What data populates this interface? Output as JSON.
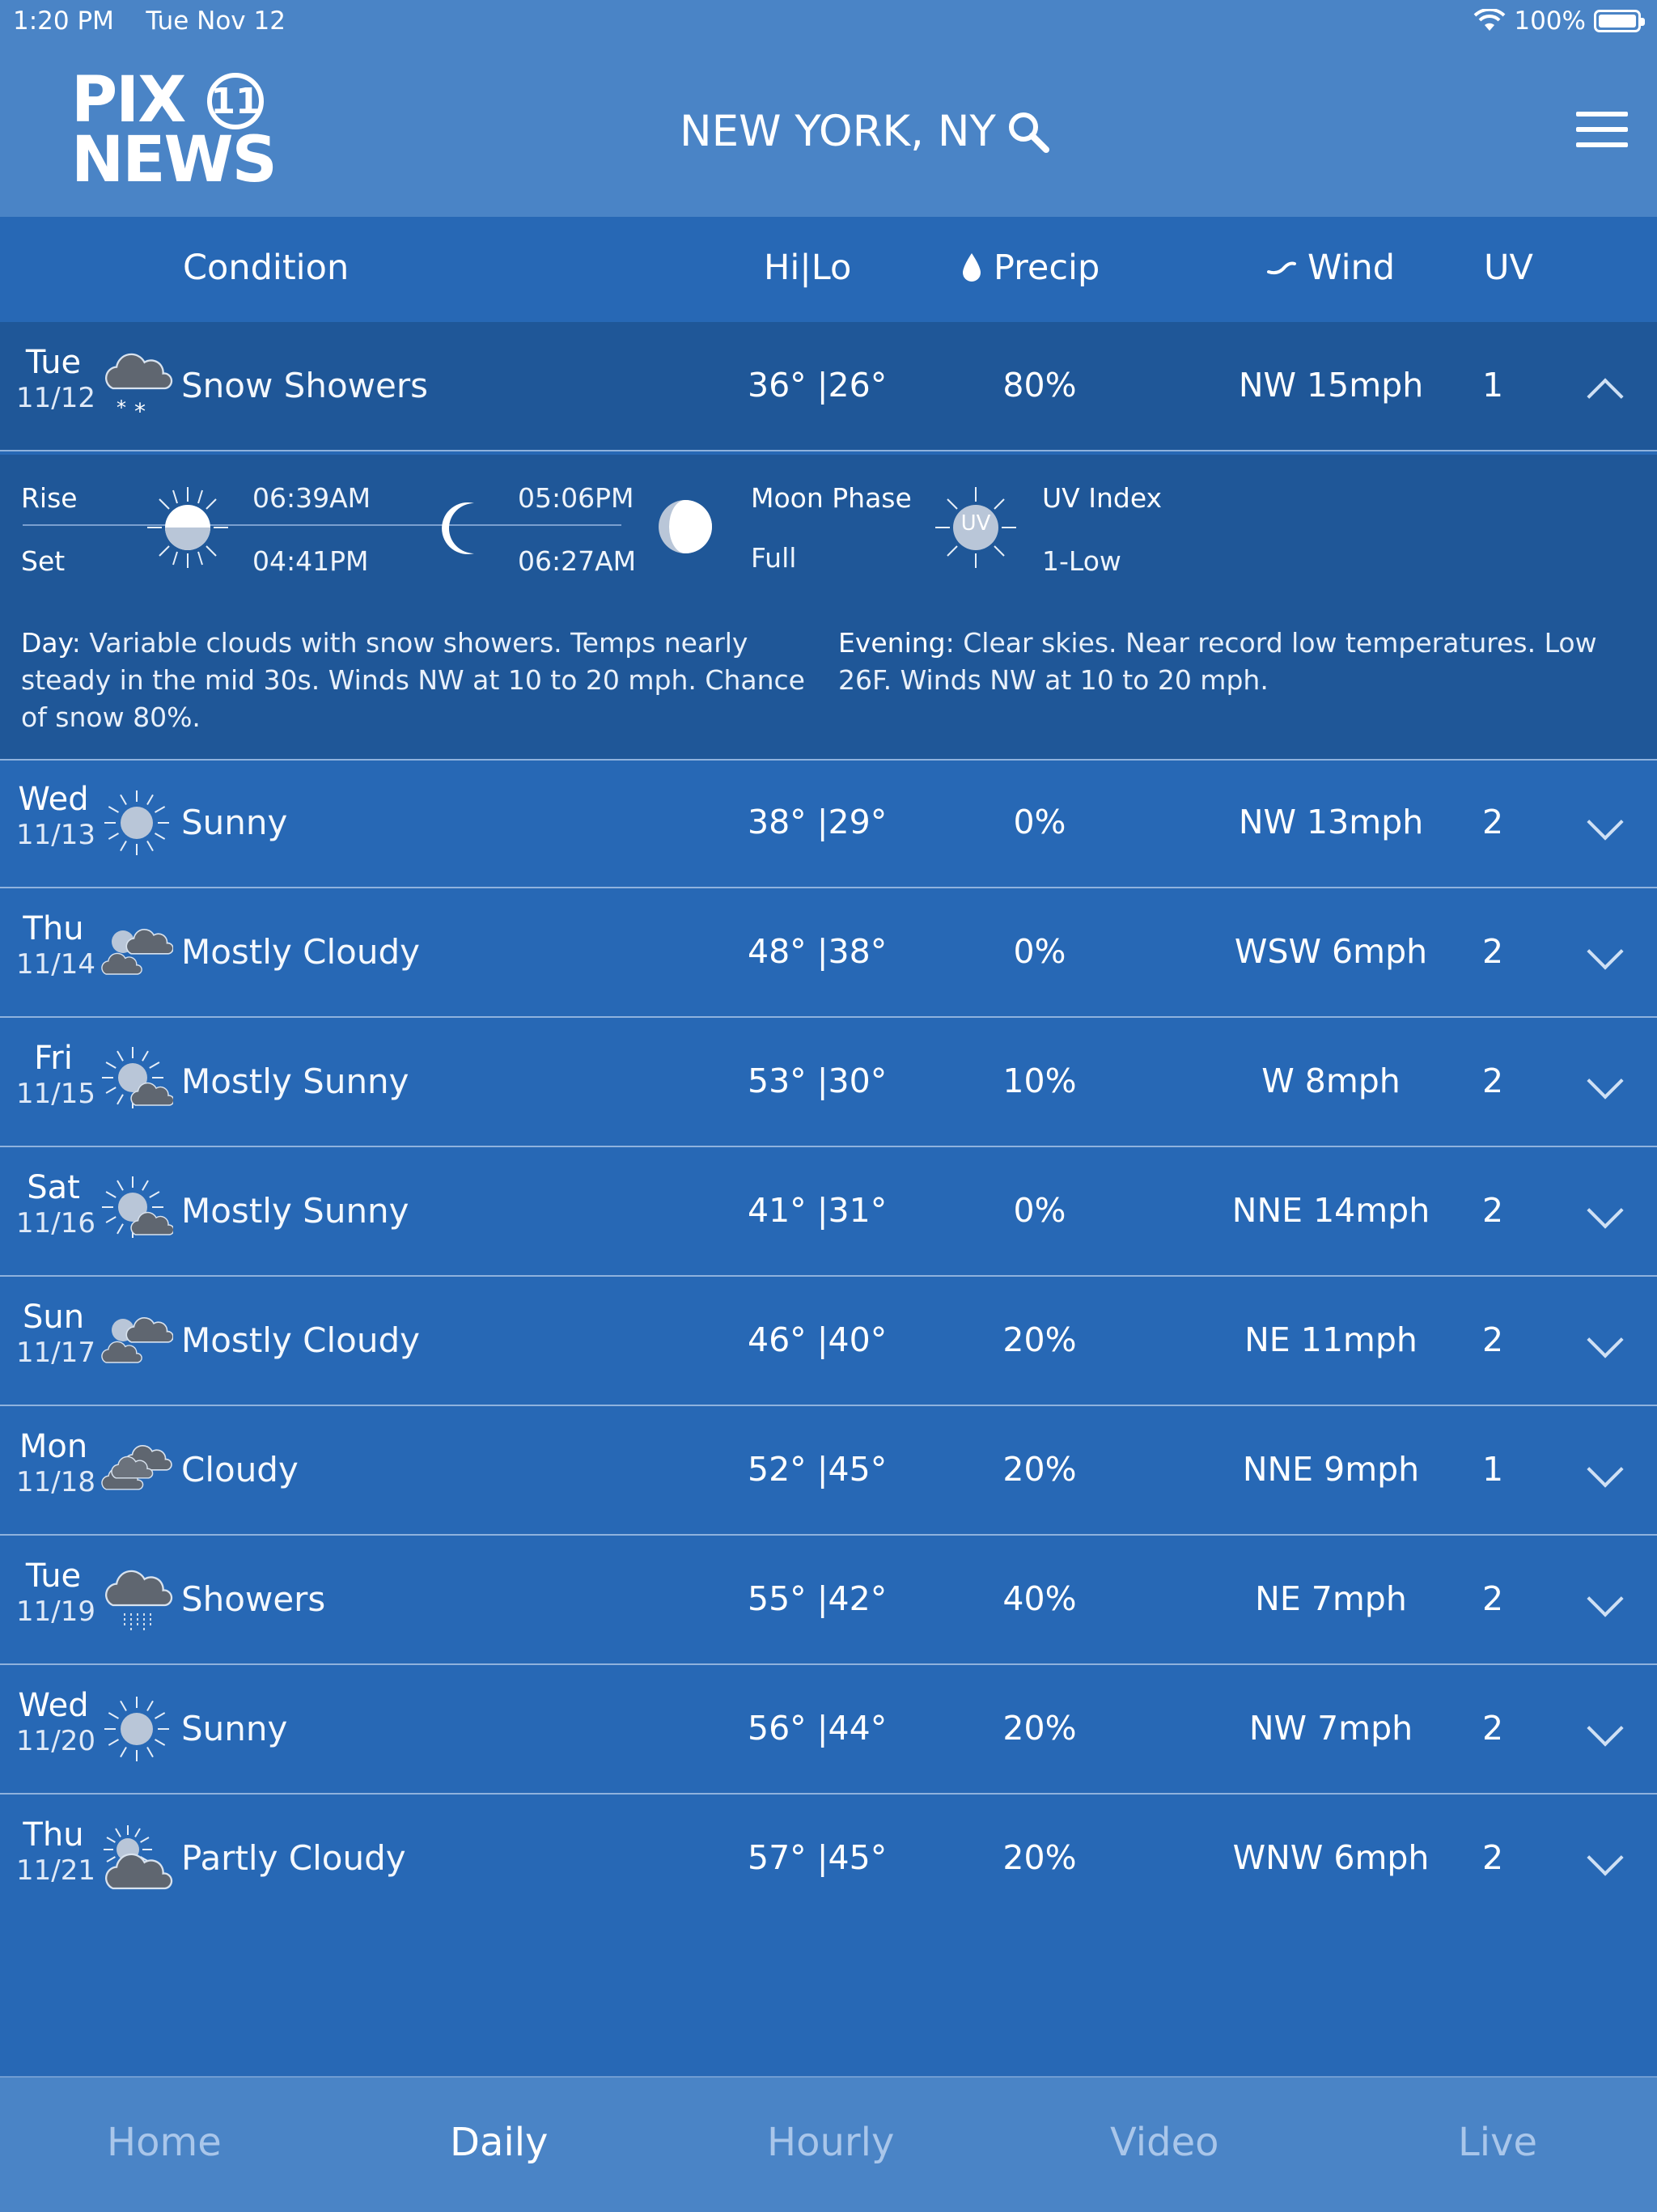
{
  "status": {
    "time": "1:20 PM",
    "date": "Tue Nov 12",
    "battery": "100%"
  },
  "header": {
    "location": "NEW YORK, NY",
    "logo_top": "PIX",
    "logo_badge": "11",
    "logo_bottom": "NEWS"
  },
  "columns": {
    "condition": "Condition",
    "hilo": "Hi|Lo",
    "precip": "Precip",
    "wind": "Wind",
    "uv": "UV"
  },
  "rows": [
    {
      "day": "Tue",
      "date": "11/12",
      "icon": "snow-showers-icon",
      "condition": "Snow Showers",
      "hilo": "36° |26°",
      "precip": "80%",
      "wind": "NW 15mph",
      "uv": "1"
    },
    {
      "day": "Wed",
      "date": "11/13",
      "icon": "sun-icon",
      "condition": "Sunny",
      "hilo": "38° |29°",
      "precip": "0%",
      "wind": "NW 13mph",
      "uv": "2"
    },
    {
      "day": "Thu",
      "date": "11/14",
      "icon": "mostly-cloudy-icon",
      "condition": "Mostly Cloudy",
      "hilo": "48° |38°",
      "precip": "0%",
      "wind": "WSW 6mph",
      "uv": "2"
    },
    {
      "day": "Fri",
      "date": "11/15",
      "icon": "mostly-sunny-icon",
      "condition": "Mostly Sunny",
      "hilo": "53° |30°",
      "precip": "10%",
      "wind": "W 8mph",
      "uv": "2"
    },
    {
      "day": "Sat",
      "date": "11/16",
      "icon": "mostly-sunny-icon",
      "condition": "Mostly Sunny",
      "hilo": "41° |31°",
      "precip": "0%",
      "wind": "NNE 14mph",
      "uv": "2"
    },
    {
      "day": "Sun",
      "date": "11/17",
      "icon": "mostly-cloudy-icon",
      "condition": "Mostly Cloudy",
      "hilo": "46° |40°",
      "precip": "20%",
      "wind": "NE 11mph",
      "uv": "2"
    },
    {
      "day": "Mon",
      "date": "11/18",
      "icon": "cloudy-icon",
      "condition": "Cloudy",
      "hilo": "52° |45°",
      "precip": "20%",
      "wind": "NNE 9mph",
      "uv": "1"
    },
    {
      "day": "Tue",
      "date": "11/19",
      "icon": "showers-icon",
      "condition": "Showers",
      "hilo": "55° |42°",
      "precip": "40%",
      "wind": "NE 7mph",
      "uv": "2"
    },
    {
      "day": "Wed",
      "date": "11/20",
      "icon": "sun-icon",
      "condition": "Sunny",
      "hilo": "56° |44°",
      "precip": "20%",
      "wind": "NW 7mph",
      "uv": "2"
    },
    {
      "day": "Thu",
      "date": "11/21",
      "icon": "partly-cloudy-icon",
      "condition": "Partly Cloudy",
      "hilo": "57° |45°",
      "precip": "20%",
      "wind": "WNW 6mph",
      "uv": "2"
    }
  ],
  "details": {
    "rise_label": "Rise",
    "set_label": "Set",
    "sunrise": "06:39AM",
    "sunset": "04:41PM",
    "moonrise": "05:06PM",
    "moonset": "06:27AM",
    "moon_phase_label": "Moon Phase",
    "moon_phase": "Full",
    "uv_label": "UV Index",
    "uv_value": "1-Low",
    "uv_badge": "UV",
    "day_label": "Day",
    "day_text": ": Variable clouds with snow showers. Temps nearly steady in the mid 30s. Winds NW at 10 to 20 mph. Chance of snow 80%.",
    "evening_label": "Evening",
    "evening_text": ": Clear skies. Near record low temperatures. Low 26F. Winds NW at 10 to 20 mph."
  },
  "tabs": [
    {
      "label": "Home",
      "active": false
    },
    {
      "label": "Daily",
      "active": true
    },
    {
      "label": "Hourly",
      "active": false
    },
    {
      "label": "Video",
      "active": false
    },
    {
      "label": "Live",
      "active": false
    }
  ]
}
